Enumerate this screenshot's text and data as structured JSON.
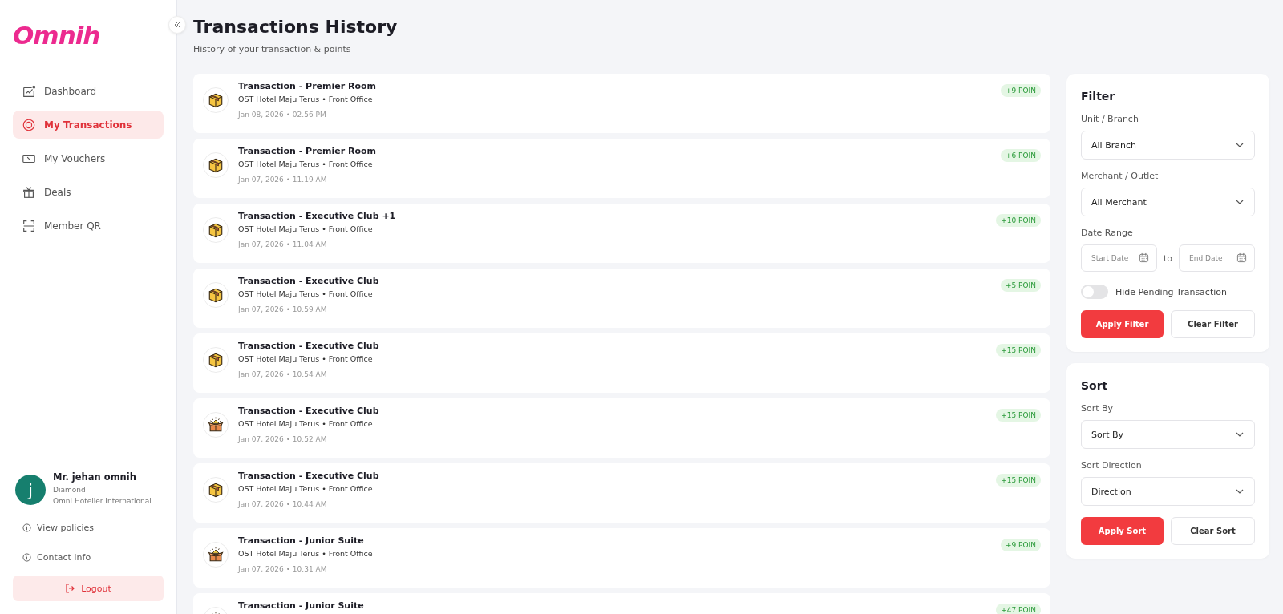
{
  "sidebar": {
    "logo": "Omnih",
    "items": [
      {
        "label": "Dashboard",
        "kind": "chart",
        "selected": false
      },
      {
        "label": "My Transactions",
        "kind": "coin",
        "selected": true
      },
      {
        "label": "My Vouchers",
        "kind": "voucher",
        "selected": false
      },
      {
        "label": "Deals",
        "kind": "gift",
        "selected": false
      },
      {
        "label": "Member QR",
        "kind": "scan",
        "selected": false
      }
    ],
    "user": {
      "avatar": "j",
      "name": "Mr. jehan omnih",
      "tier": "Diamond",
      "company": "Omni Hotelier International"
    },
    "links": [
      "View policies",
      "Contact Info"
    ],
    "logout": "Logout"
  },
  "header": {
    "title": "Transactions History",
    "subtitle": "History of your transaction & points"
  },
  "transactions": [
    {
      "kind": "box",
      "title": "Transaction - Premier Room",
      "place": "OST Hotel Maju Terus • Front Office",
      "date": "Jan 08, 2026 • 02.56 PM",
      "points": "+9 POIN"
    },
    {
      "kind": "box",
      "title": "Transaction - Premier Room",
      "place": "OST Hotel Maju Terus • Front Office",
      "date": "Jan 07, 2026 • 11.19 AM",
      "points": "+6 POIN"
    },
    {
      "kind": "box",
      "title": "Transaction - Executive Club +1",
      "place": "OST Hotel Maju Terus • Front Office",
      "date": "Jan 07, 2026 • 11.04 AM",
      "points": "+10 POIN"
    },
    {
      "kind": "box",
      "title": "Transaction - Executive Club",
      "place": "OST Hotel Maju Terus • Front Office",
      "date": "Jan 07, 2026 • 10.59 AM",
      "points": "+5 POIN"
    },
    {
      "kind": "box",
      "title": "Transaction - Executive Club",
      "place": "OST Hotel Maju Terus • Front Office",
      "date": "Jan 07, 2026 • 10.54 AM",
      "points": "+15 POIN"
    },
    {
      "kind": "gift",
      "title": "Transaction - Executive Club",
      "place": "OST Hotel Maju Terus • Front Office",
      "date": "Jan 07, 2026 • 10.52 AM",
      "points": "+15 POIN"
    },
    {
      "kind": "box",
      "title": "Transaction - Executive Club",
      "place": "OST Hotel Maju Terus • Front Office",
      "date": "Jan 07, 2026 • 10.44 AM",
      "points": "+15 POIN"
    },
    {
      "kind": "gift",
      "title": "Transaction - Junior Suite",
      "place": "OST Hotel Maju Terus • Front Office",
      "date": "Jan 07, 2026 • 10.31 AM",
      "points": "+9 POIN"
    },
    {
      "kind": "gift",
      "title": "Transaction - Junior Suite",
      "points": "+47 POIN"
    }
  ],
  "filter": {
    "title": "Filter",
    "fields": [
      {
        "label": "Unit / Branch",
        "value": "All Branch"
      },
      {
        "label": "Merchant / Outlet",
        "value": "All Merchant"
      }
    ],
    "date_range": {
      "label": "Date Range",
      "start_placeholder": "Start Date",
      "separator": "to",
      "end_placeholder": "End Date"
    },
    "toggle": {
      "label": "Hide Pending Transaction",
      "on": false
    },
    "buttons": [
      "Apply Filter",
      "Clear Filter"
    ]
  },
  "sort": {
    "title": "Sort",
    "fields": [
      {
        "label": "Sort By",
        "value": "Sort By"
      },
      {
        "label": "Sort Direction",
        "value": "Direction"
      }
    ],
    "buttons": [
      "Apply Sort",
      "Clear Sort"
    ]
  }
}
